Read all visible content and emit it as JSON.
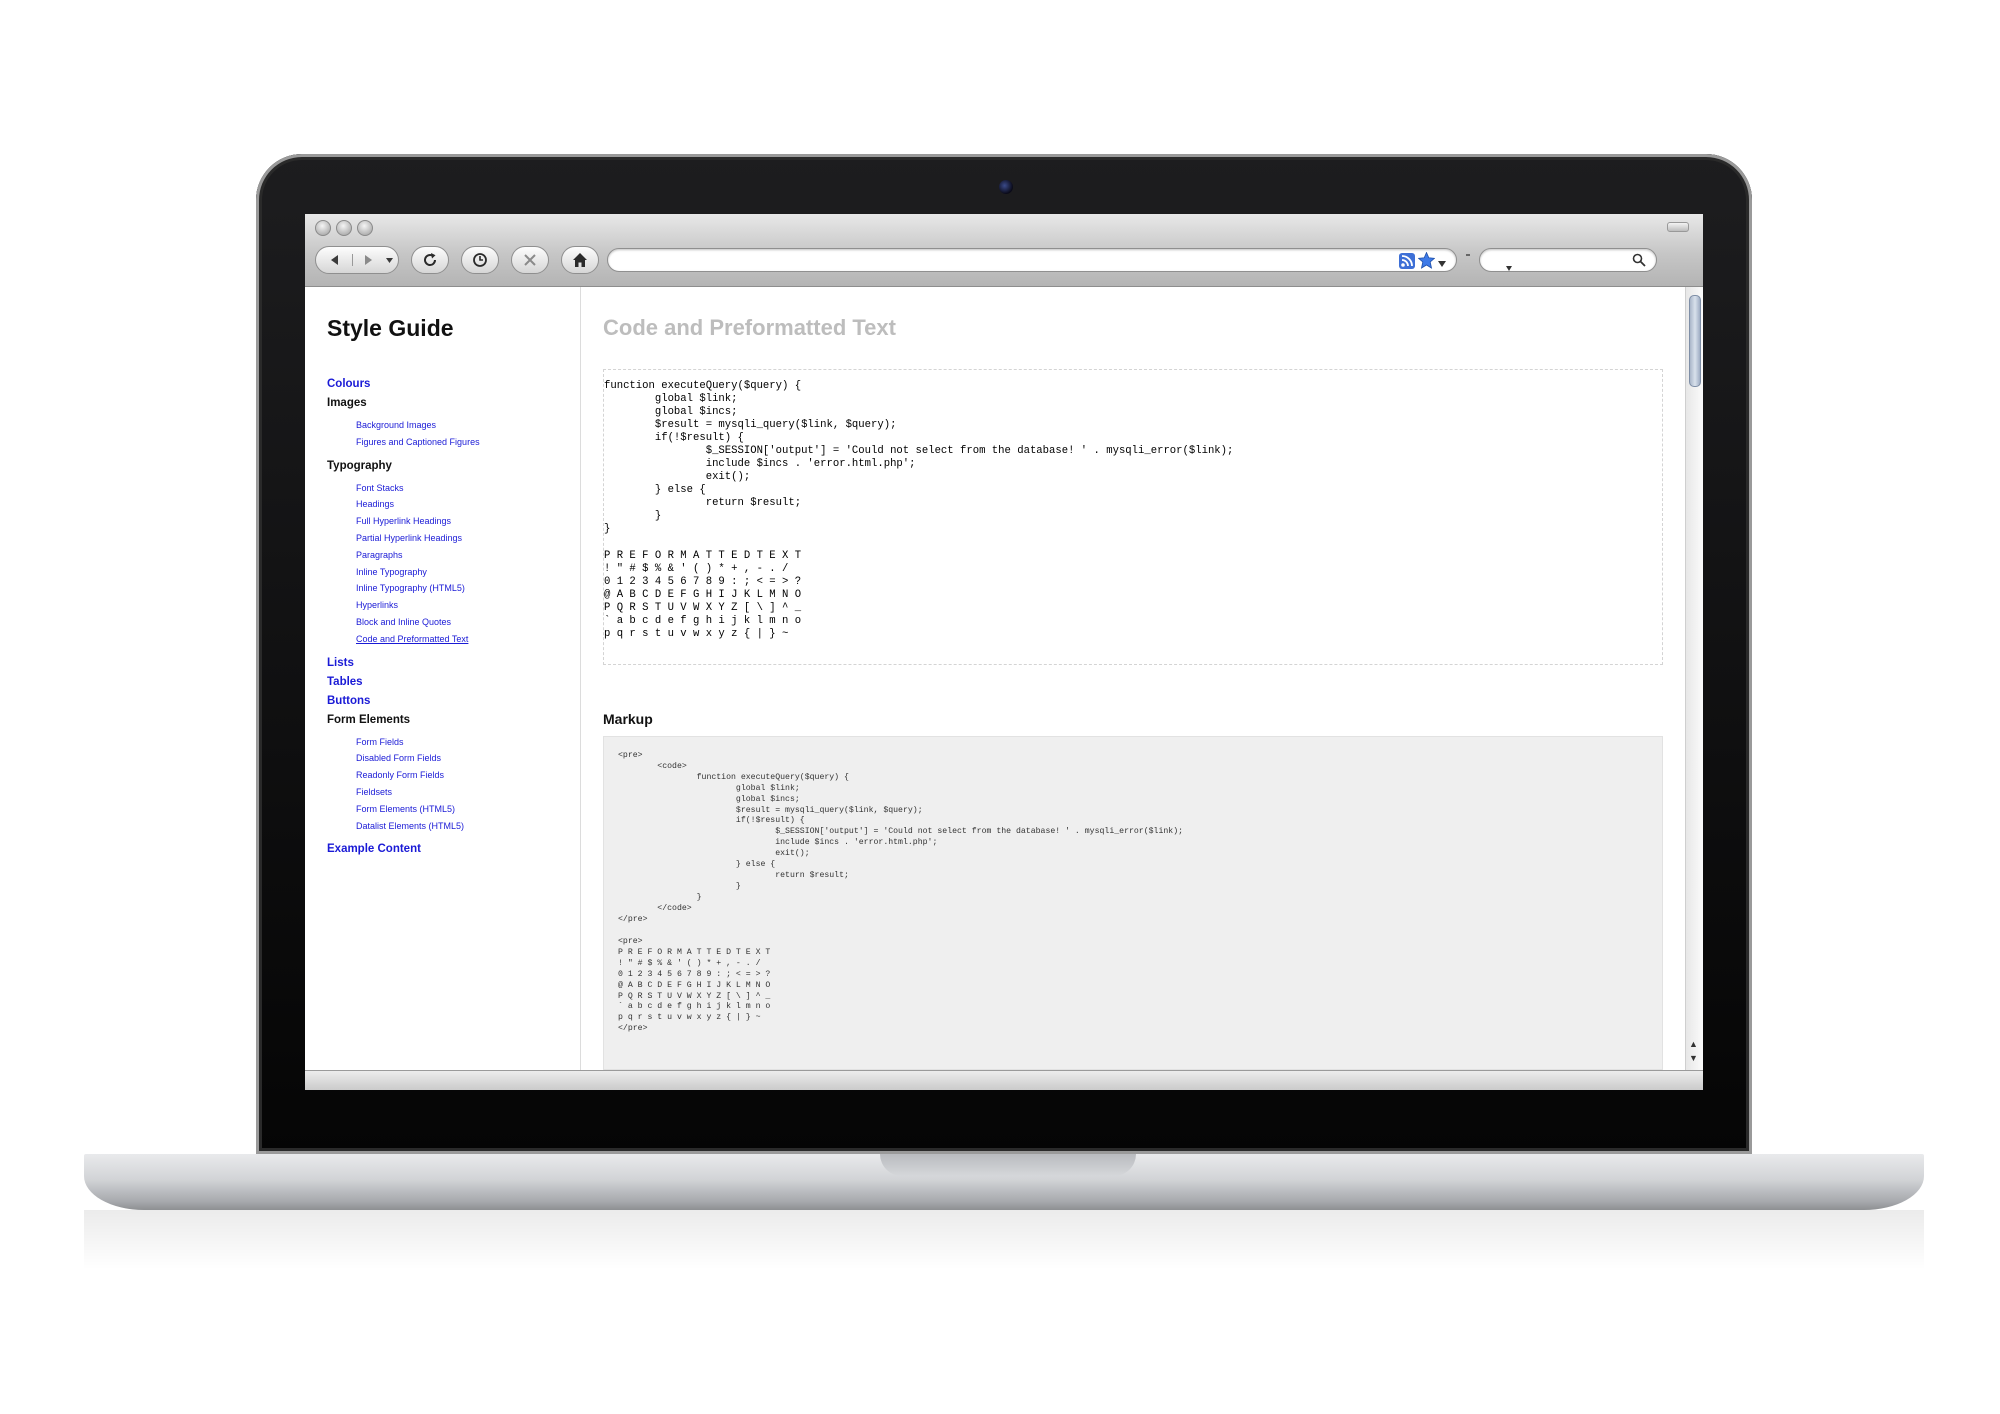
{
  "browser": {
    "url_value": "",
    "search_value": ""
  },
  "sidebar": {
    "title": "Style Guide",
    "nav": [
      {
        "label": "Colours",
        "kind": "link"
      },
      {
        "label": "Images",
        "kind": "plain",
        "children": [
          "Background Images",
          "Figures and Captioned Figures"
        ]
      },
      {
        "label": "Typography",
        "kind": "plain",
        "children": [
          "Font Stacks",
          "Headings",
          "Full Hyperlink Headings",
          "Partial Hyperlink Headings",
          "Paragraphs",
          "Inline Typography",
          "Inline Typography (HTML5)",
          "Hyperlinks",
          "Block and Inline Quotes",
          "Code and Preformatted Text"
        ]
      },
      {
        "label": "Lists",
        "kind": "link"
      },
      {
        "label": "Tables",
        "kind": "link"
      },
      {
        "label": "Buttons",
        "kind": "link"
      },
      {
        "label": "Form Elements",
        "kind": "plain",
        "children": [
          "Form Fields",
          "Disabled Form Fields",
          "Readonly Form Fields",
          "Fieldsets",
          "Form Elements (HTML5)",
          "Datalist Elements (HTML5)"
        ]
      },
      {
        "label": "Example Content",
        "kind": "link"
      }
    ],
    "current": "Code and Preformatted Text"
  },
  "main": {
    "heading": "Code and Preformatted Text",
    "code_example": "function executeQuery($query) {\n        global $link;\n        global $incs;\n        $result = mysqli_query($link, $query);\n        if(!$result) {\n                $_SESSION['output'] = 'Could not select from the database! ' . mysqli_error($link);\n                include $incs . 'error.html.php';\n                exit();\n        } else {\n                return $result;\n        }\n}",
    "preformatted_example": "P R E F O R M A T T E D T E X T\n! \" # $ % & ' ( ) * + , - . /\n0 1 2 3 4 5 6 7 8 9 : ; < = > ?\n@ A B C D E F G H I J K L M N O\nP Q R S T U V W X Y Z [ \\ ] ^ _\n` a b c d e f g h i j k l m n o\np q r s t u v w x y z { | } ~",
    "markup_title": "Markup",
    "markup_code": "<pre>\n        <code>\n                function executeQuery($query) {\n                        global $link;\n                        global $incs;\n                        $result = mysqli_query($link, $query);\n                        if(!$result) {\n                                $_SESSION['output'] = 'Could not select from the database! ' . mysqli_error($link);\n                                include $incs . 'error.html.php';\n                                exit();\n                        } else {\n                                return $result;\n                        }\n                }\n        </code>\n</pre>",
    "markup_pre": "<pre>\nP R E F O R M A T T E D T E X T\n! \" # $ % & ' ( ) * + , - . /\n0 1 2 3 4 5 6 7 8 9 : ; < = > ?\n@ A B C D E F G H I J K L M N O\nP Q R S T U V W X Y Z [ \\ ] ^ _\n` a b c d e f g h i j k l m n o\np q r s t u v w x y z { | } ~\n</pre>"
  },
  "icons": {
    "back": "back-arrow-icon",
    "forward": "forward-arrow-icon",
    "reload": "reload-icon",
    "history": "clock-icon",
    "stop": "stop-x-icon",
    "home": "home-icon",
    "rss": "rss-feed-icon",
    "bookmark": "star-icon",
    "search": "magnifier-icon"
  },
  "colors": {
    "link": "#1a1ad6",
    "heading_muted": "#bdbdbd",
    "markup_bg": "#efefef"
  }
}
